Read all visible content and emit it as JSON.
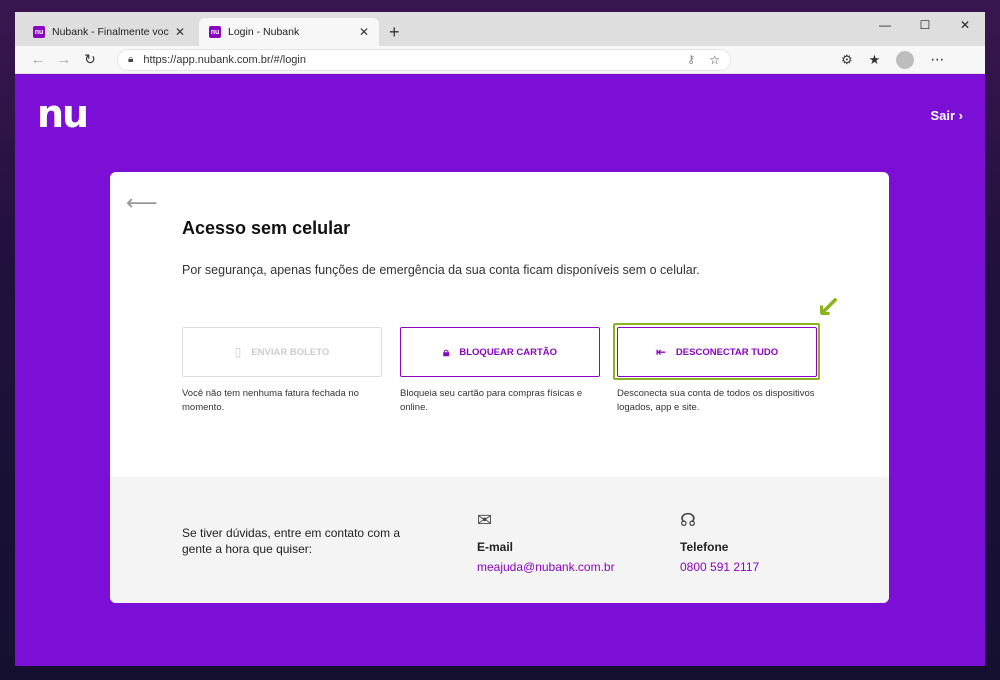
{
  "browser": {
    "tabs": [
      {
        "title": "Nubank - Finalmente você no co",
        "favicon": "nu"
      },
      {
        "title": "Login - Nubank",
        "favicon": "nu"
      }
    ],
    "new_tab": "+",
    "window_controls": {
      "minimize": "—",
      "maximize": "☐",
      "close": "✕"
    },
    "url": "https://app.nubank.com.br/#/login"
  },
  "header": {
    "logo": "nu",
    "logout": "Sair ›"
  },
  "card": {
    "title": "Acesso sem celular",
    "description": "Por segurança, apenas funções de emergência da sua conta ficam disponíveis sem o celular.",
    "options": [
      {
        "label": "ENVIAR BOLETO",
        "description": "Você não tem nenhuma fatura fechada no momento.",
        "enabled": false
      },
      {
        "label": "BLOQUEAR CARTÃO",
        "description": "Bloqueia seu cartão para compras físicas e online.",
        "enabled": true
      },
      {
        "label": "DESCONECTAR TUDO",
        "description": "Desconecta sua conta de todos os dispositivos logados, app e site.",
        "enabled": true
      }
    ]
  },
  "footer": {
    "help_text": "Se tiver dúvidas, entre em contato com a gente a hora que quiser:",
    "email": {
      "label": "E-mail",
      "value": "meajuda@nubank.com.br"
    },
    "phone": {
      "label": "Telefone",
      "value": "0800 591 2117"
    }
  },
  "colors": {
    "brand": "#8a05be",
    "highlight": "#8ab31d"
  }
}
